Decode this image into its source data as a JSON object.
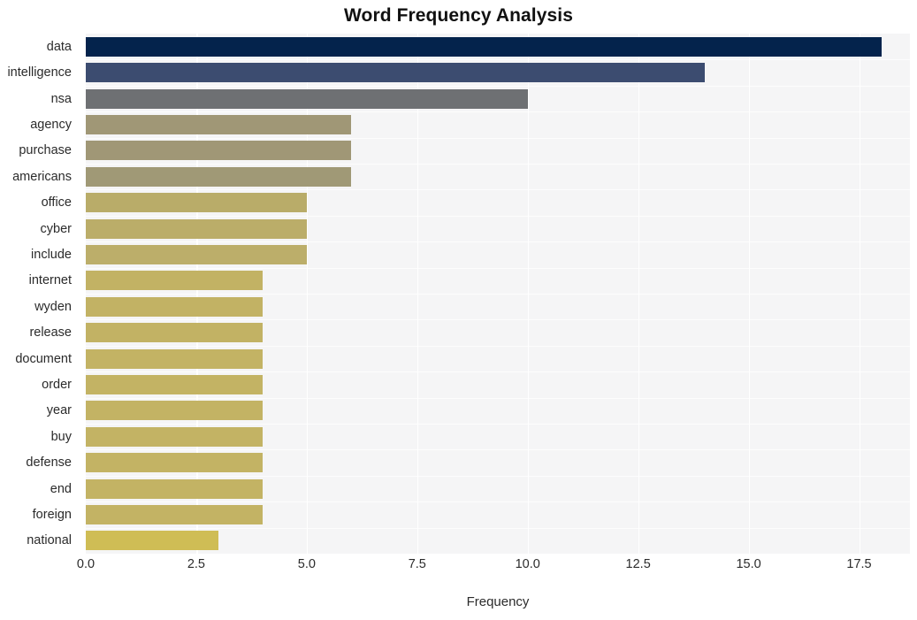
{
  "chart_data": {
    "type": "bar",
    "orientation": "horizontal",
    "title": "Word Frequency Analysis",
    "xlabel": "Frequency",
    "ylabel": "",
    "xlim": [
      0,
      18.65
    ],
    "xticks": [
      "0.0",
      "2.5",
      "5.0",
      "7.5",
      "10.0",
      "12.5",
      "15.0",
      "17.5"
    ],
    "xtick_values": [
      0,
      2.5,
      5,
      7.5,
      10,
      12.5,
      15,
      17.5
    ],
    "grid": "vertical-white",
    "legend": "none",
    "categories": [
      "data",
      "intelligence",
      "nsa",
      "agency",
      "purchase",
      "americans",
      "office",
      "cyber",
      "include",
      "internet",
      "wyden",
      "release",
      "document",
      "order",
      "year",
      "buy",
      "defense",
      "end",
      "foreign",
      "national"
    ],
    "values": [
      18,
      14,
      10,
      6,
      6,
      6,
      5,
      5,
      5,
      4,
      4,
      4,
      4,
      4,
      4,
      4,
      4,
      4,
      4,
      3
    ],
    "bar_colors": [
      "#04234c",
      "#3c4c70",
      "#6e7073",
      "#a09776",
      "#a09776",
      "#a09976",
      "#b9ac69",
      "#bbad69",
      "#bcae6a",
      "#c2b264",
      "#c2b264",
      "#c2b264",
      "#c3b364",
      "#c3b364",
      "#c3b364",
      "#c3b364",
      "#c3b364",
      "#c3b364",
      "#c3b364",
      "#cfbd55"
    ],
    "plot_background": "#f5f5f6",
    "figure_background": "#ffffff",
    "title_color": "#111111",
    "tick_color": "#2b2b2b"
  }
}
